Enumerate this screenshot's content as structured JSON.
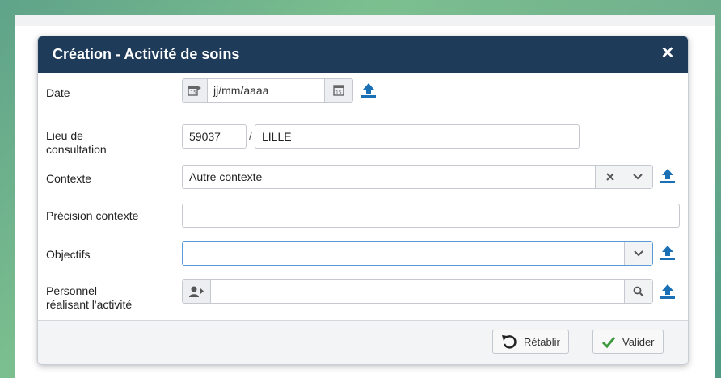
{
  "dialog": {
    "title": "Création - Activité de soins",
    "close_symbol": "✕"
  },
  "form": {
    "date": {
      "label": "Date",
      "placeholder": "jj/mm/aaaa"
    },
    "lieu": {
      "label_line1": "Lieu de",
      "label_line2": "consultation",
      "code": "59037",
      "separator": "/",
      "city": "LILLE"
    },
    "contexte": {
      "label": "Contexte",
      "value": "Autre contexte"
    },
    "precision": {
      "label": "Précision contexte",
      "value": ""
    },
    "objectifs": {
      "label": "Objectifs",
      "value": ""
    },
    "personnel": {
      "label_line1": "Personnel",
      "label_line2": "réalisant l'activité",
      "value": ""
    }
  },
  "footer": {
    "reset_label": "Rétablir",
    "submit_label": "Valider"
  },
  "colors": {
    "header_bg": "#1f3b5a",
    "accent_blue": "#1a6fb5",
    "check_green": "#3c9a3c"
  },
  "icons": [
    "calendar-import-icon",
    "calendar-icon",
    "upload-icon",
    "clear-icon",
    "chevron-down-icon",
    "user-import-icon",
    "search-icon",
    "undo-icon",
    "check-icon",
    "close-icon"
  ]
}
